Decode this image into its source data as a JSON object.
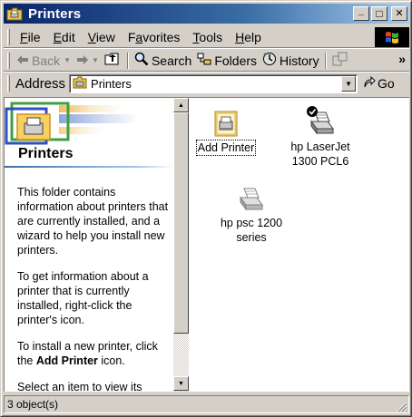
{
  "window": {
    "title": "Printers",
    "minimize_glyph": "_",
    "maximize_glyph": "□",
    "close_glyph": "✕"
  },
  "menu": [
    {
      "key": "F",
      "rest": "ile"
    },
    {
      "key": "E",
      "rest": "dit"
    },
    {
      "key": "V",
      "rest": "iew"
    },
    {
      "key": "a",
      "pre": "F",
      "rest": "vorites"
    },
    {
      "key": "T",
      "rest": "ools"
    },
    {
      "key": "H",
      "rest": "elp"
    }
  ],
  "toolbar": {
    "back": "Back",
    "search": "Search",
    "folders": "Folders",
    "history": "History",
    "more": "»"
  },
  "address": {
    "label": "Address",
    "value": "Printers",
    "go": "Go"
  },
  "leftpane": {
    "title": "Printers",
    "para1": "This folder contains information about printers that are currently installed, and a wizard to help you install new printers.",
    "para2": "To get information about a printer that is currently installed, right-click the printer's icon.",
    "para3_pre": "To install a new printer, click the ",
    "para3_bold": "Add Printer",
    "para3_post": " icon.",
    "para4": "Select an item to view its"
  },
  "items": [
    {
      "name": "Add Printer",
      "icon": "add-printer-icon",
      "selected": true
    },
    {
      "name1": "hp LaserJet",
      "name2": "1300 PCL6",
      "icon": "printer-default-icon"
    },
    {
      "name1": "hp psc 1200",
      "name2": "series",
      "icon": "printer-icon"
    }
  ],
  "status": {
    "text": "3 object(s)"
  },
  "colors": {
    "title_start": "#0a246a",
    "title_end": "#a6caf0",
    "face": "#d4d0c8"
  }
}
